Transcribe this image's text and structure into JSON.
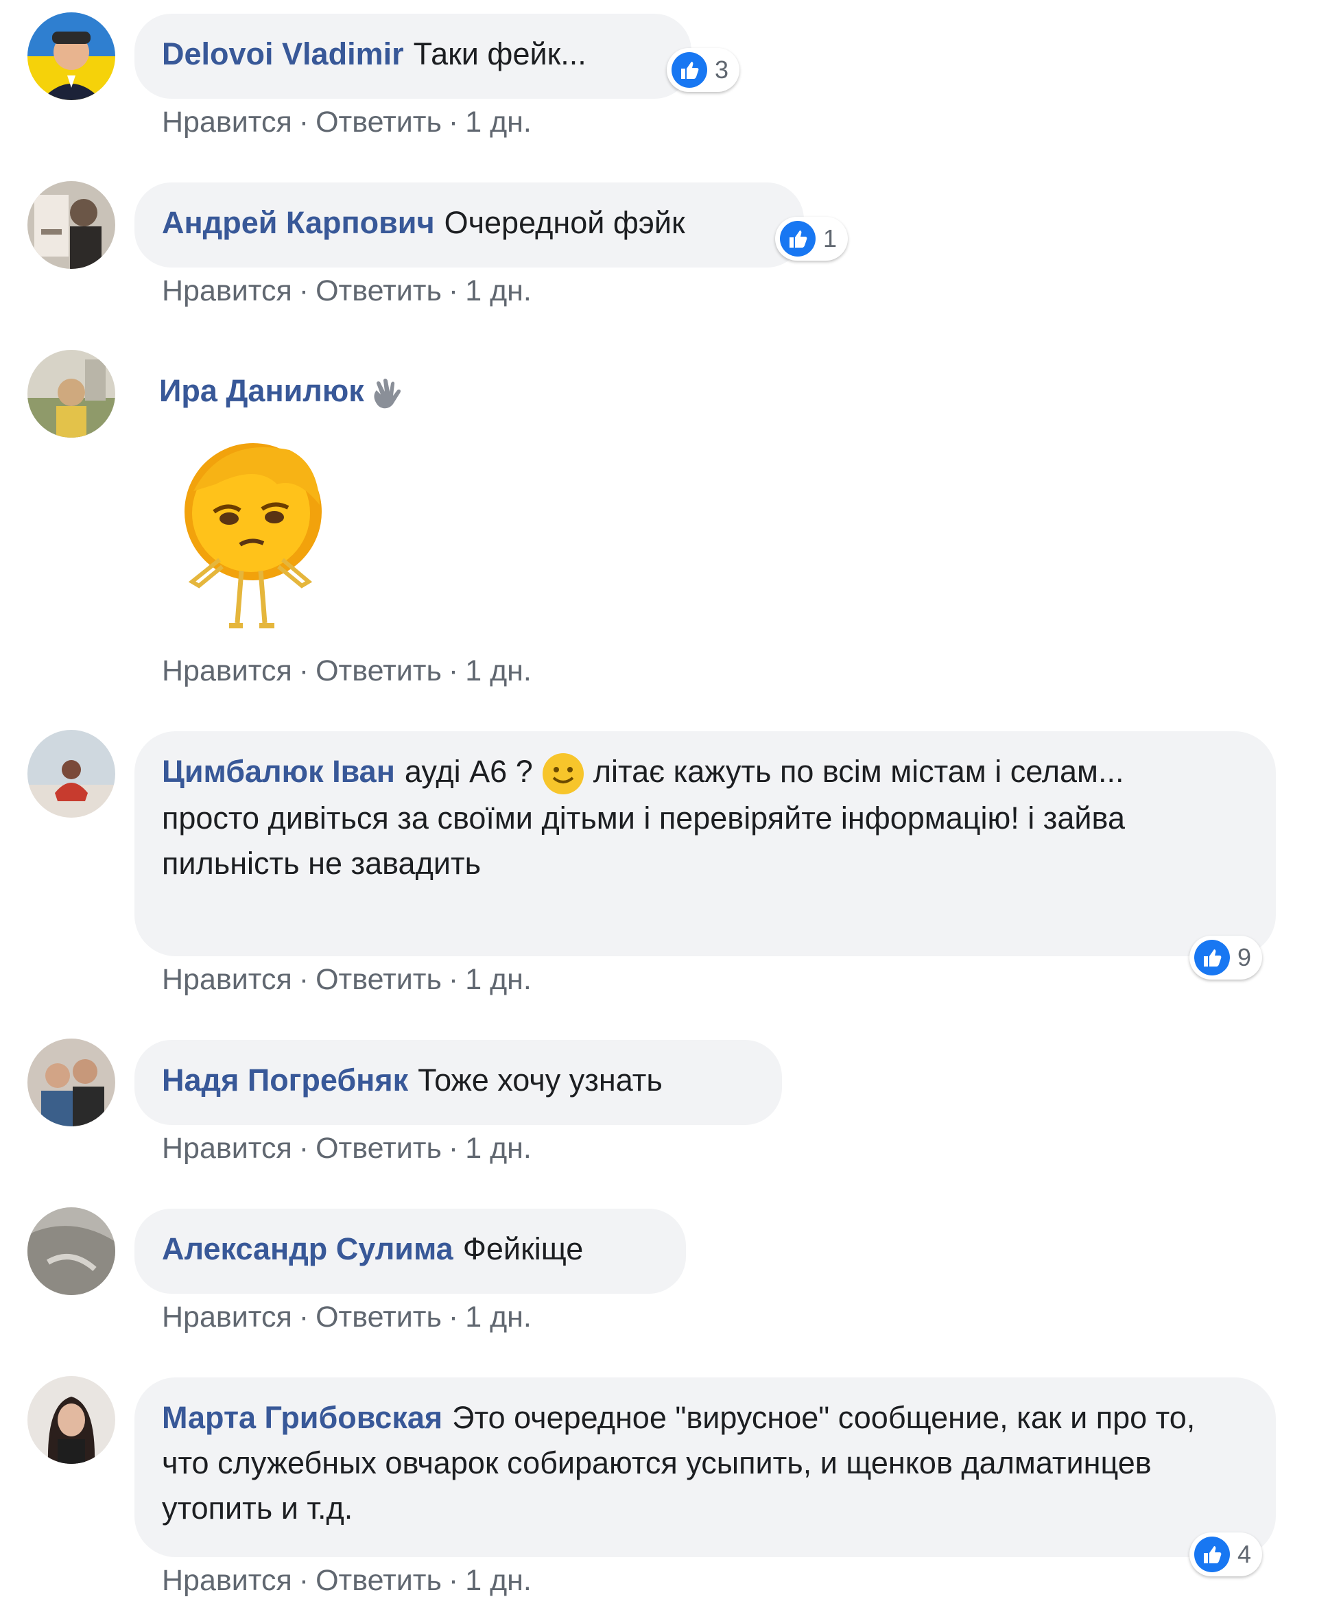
{
  "actions": {
    "like": "Нравится",
    "reply": "Ответить",
    "time": "1 дн.",
    "separator": "·"
  },
  "comments": [
    {
      "author": "Delovoi Vladimir",
      "text": "Таки фейк...",
      "likes": "3"
    },
    {
      "author": "Андрей Карпович",
      "text": "Очередной фэйк",
      "likes": "1"
    },
    {
      "author": "Ира Данилюк",
      "sticker": "shrug-emoji-sticker"
    },
    {
      "author": "Цимбалюк Іван",
      "text_before_emoji": "ауді А6 ?",
      "text_after_emoji": "літає кажуть по всім містам і селам...",
      "text_line2": "просто дивіться за своїми дітьми і перевіряйте інформацію! і зайва пильність не завадить",
      "likes": "9"
    },
    {
      "author": "Надя Погребняк",
      "text": "Тоже хочу узнать"
    },
    {
      "author": "Александр Сулима",
      "text": "Фейкіще"
    },
    {
      "author": "Марта Грибовская",
      "text": "Это очередное \"вирусное\" сообщение, как и про то, что служебных овчарок собираются усыпить, и щенков далматинцев утопить и т.д.",
      "likes": "4"
    }
  ],
  "colors": {
    "author": "#385898",
    "bubble": "#f2f3f5",
    "like_blue": "#1877f2",
    "muted": "#606770"
  }
}
